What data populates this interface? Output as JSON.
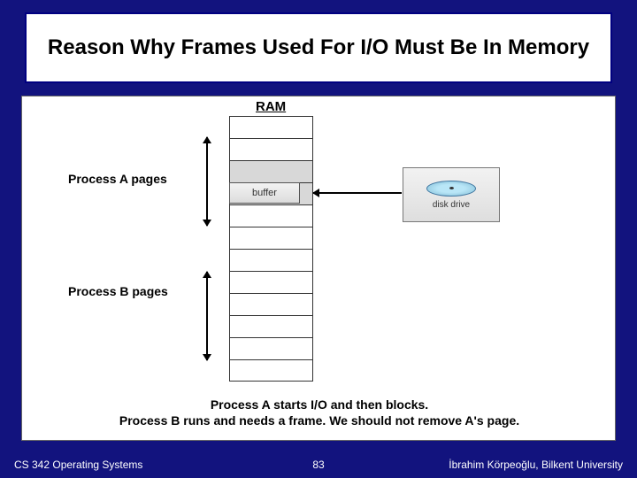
{
  "title": "Reason Why Frames Used For I/O Must Be In Memory",
  "diagram": {
    "ram_label": "RAM",
    "process_a_label": "Process A pages",
    "process_b_label": "Process B pages",
    "buffer_label": "buffer",
    "disk_label": "disk drive"
  },
  "caption": {
    "line1": "Process A starts I/O and then blocks.",
    "line2": "Process B runs and needs a frame. We should not remove A's page."
  },
  "footer": {
    "course": "CS 342 Operating Systems",
    "slide_number": "83",
    "author": "İbrahim Körpeoğlu, Bilkent University"
  }
}
